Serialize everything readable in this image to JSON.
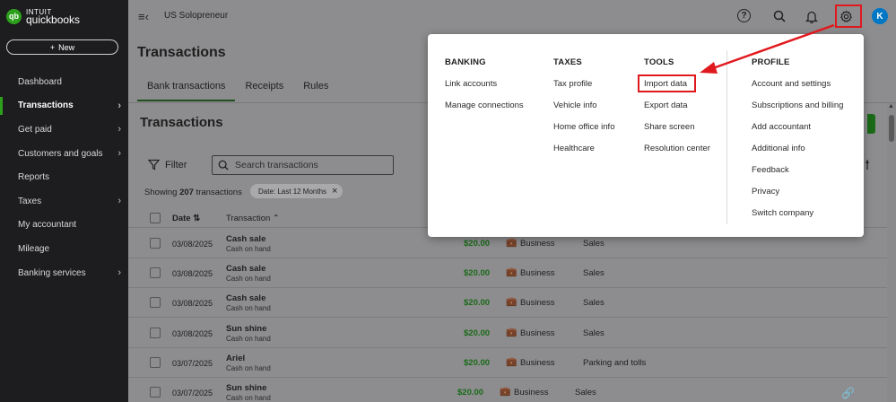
{
  "sidebar": {
    "logo": {
      "badge": "qb",
      "line1": "INTUIT",
      "line2": "quickbooks"
    },
    "new_button": {
      "icon": "+",
      "label": "New"
    },
    "items": [
      {
        "label": "Dashboard",
        "chevron": ""
      },
      {
        "label": "Transactions",
        "chevron": "›",
        "active": true
      },
      {
        "label": "Get paid",
        "chevron": "›"
      },
      {
        "label": "Customers and goals",
        "chevron": "›"
      },
      {
        "label": "Reports",
        "chevron": ""
      },
      {
        "label": "Taxes",
        "chevron": "›"
      },
      {
        "label": "My accountant",
        "chevron": ""
      },
      {
        "label": "Mileage",
        "chevron": ""
      },
      {
        "label": "Banking services",
        "chevron": "›"
      }
    ]
  },
  "topbar": {
    "menu_icon": "≡‹",
    "company": "US Solopreneur",
    "help_icon": "?",
    "search_icon": "search-icon",
    "bell_icon": "bell-icon",
    "gear_icon": "gear-icon",
    "avatar": "K"
  },
  "page": {
    "title": "Transactions",
    "tabs": [
      "Bank transactions",
      "Receipts",
      "Rules"
    ],
    "section_title": "Transactions",
    "filter_label": "Filter",
    "search_placeholder": "Search transactions",
    "showing_prefix": "Showing",
    "showing_count": "207",
    "showing_suffix": "transactions",
    "date_chip": "Date:  Last 12 Months",
    "chip_close": "×"
  },
  "table": {
    "headers": {
      "date": "Date",
      "date_sort": "⇅",
      "transaction": "Transaction",
      "transaction_sort": "⌃"
    },
    "rows": [
      {
        "date": "03/08/2025",
        "name": "Cash sale",
        "sub": "Cash on hand",
        "amount": "$20.00",
        "class": "Business",
        "category": "Sales"
      },
      {
        "date": "03/08/2025",
        "name": "Cash sale",
        "sub": "Cash on hand",
        "amount": "$20.00",
        "class": "Business",
        "category": "Sales"
      },
      {
        "date": "03/08/2025",
        "name": "Cash sale",
        "sub": "Cash on hand",
        "amount": "$20.00",
        "class": "Business",
        "category": "Sales"
      },
      {
        "date": "03/08/2025",
        "name": "Sun shine",
        "sub": "Cash on hand",
        "amount": "$20.00",
        "class": "Business",
        "category": "Sales"
      },
      {
        "date": "03/07/2025",
        "name": "Ariel",
        "sub": "Cash on hand",
        "amount": "$20.00",
        "class": "Business",
        "category": "Parking and tolls"
      },
      {
        "date": "03/07/2025",
        "name": "Sun shine",
        "sub": "Cash on hand",
        "amount": "$20.00",
        "class": "Business",
        "category": "Sales"
      }
    ]
  },
  "dropdown": {
    "banking": {
      "heading": "BANKING",
      "items": [
        "Link accounts",
        "Manage connections"
      ]
    },
    "taxes": {
      "heading": "TAXES",
      "items": [
        "Tax profile",
        "Vehicle info",
        "Home office info",
        "Healthcare"
      ]
    },
    "tools": {
      "heading": "TOOLS",
      "items": [
        "Import data",
        "Export data",
        "Share screen",
        "Resolution center"
      ]
    },
    "profile": {
      "heading": "PROFILE",
      "items": [
        "Account and settings",
        "Subscriptions and billing",
        "Add accountant",
        "Additional info",
        "Feedback",
        "Privacy",
        "Switch company"
      ]
    }
  },
  "colors": {
    "brand_green": "#2ca01c",
    "highlight_red": "#e0191e",
    "avatar_blue": "#0077c5",
    "amount_green": "#1a6a18"
  }
}
